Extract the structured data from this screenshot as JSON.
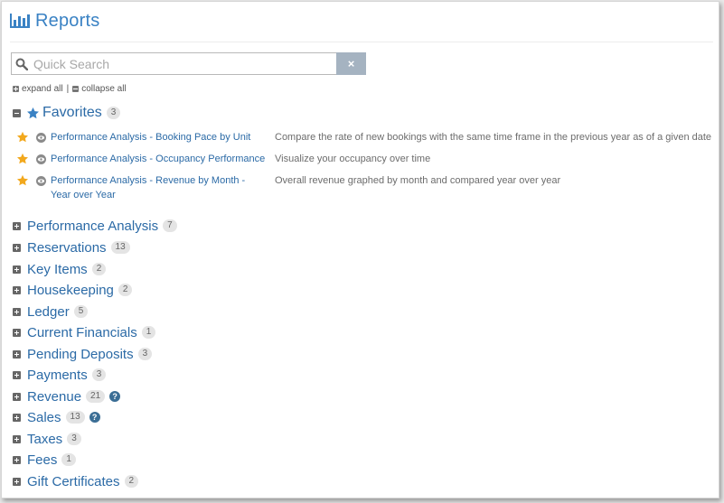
{
  "header": {
    "title": "Reports"
  },
  "search": {
    "placeholder": "Quick Search",
    "value": "",
    "clear_label": "×"
  },
  "tree_controls": {
    "expand_all": "expand all",
    "separator": "|",
    "collapse_all": "collapse all"
  },
  "favorites": {
    "title": "Favorites",
    "count": "3",
    "items": [
      {
        "title": "Performance Analysis - Booking Pace by Unit",
        "description": "Compare the rate of new bookings with the same time frame in the previous year as of a given date"
      },
      {
        "title": "Performance Analysis - Occupancy Performance",
        "description": "Visualize your occupancy over time"
      },
      {
        "title": "Performance Analysis - Revenue by Month - Year over Year",
        "description": "Overall revenue graphed by month and compared year over year"
      }
    ]
  },
  "categories": [
    {
      "label": "Performance Analysis",
      "count": "7",
      "help": false
    },
    {
      "label": "Reservations",
      "count": "13",
      "help": false
    },
    {
      "label": "Key Items",
      "count": "2",
      "help": false
    },
    {
      "label": "Housekeeping",
      "count": "2",
      "help": false
    },
    {
      "label": "Ledger",
      "count": "5",
      "help": false
    },
    {
      "label": "Current Financials",
      "count": "1",
      "help": false
    },
    {
      "label": "Pending Deposits",
      "count": "3",
      "help": false
    },
    {
      "label": "Payments",
      "count": "3",
      "help": false
    },
    {
      "label": "Revenue",
      "count": "21",
      "help": true
    },
    {
      "label": "Sales",
      "count": "13",
      "help": true
    },
    {
      "label": "Taxes",
      "count": "3",
      "help": false
    },
    {
      "label": "Fees",
      "count": "1",
      "help": false
    },
    {
      "label": "Gift Certificates",
      "count": "2",
      "help": false
    }
  ],
  "help_glyph": "?",
  "colors": {
    "link": "#2b6aa6",
    "title": "#3a82c4",
    "star": "#f2a81d",
    "clear_button": "#a5b3c1",
    "help": "#3b6e95"
  },
  "icons": {
    "title": "bar-chart-icon",
    "search": "search-icon",
    "favorites": "star-icon",
    "preview": "eye-icon",
    "help": "question-icon"
  }
}
